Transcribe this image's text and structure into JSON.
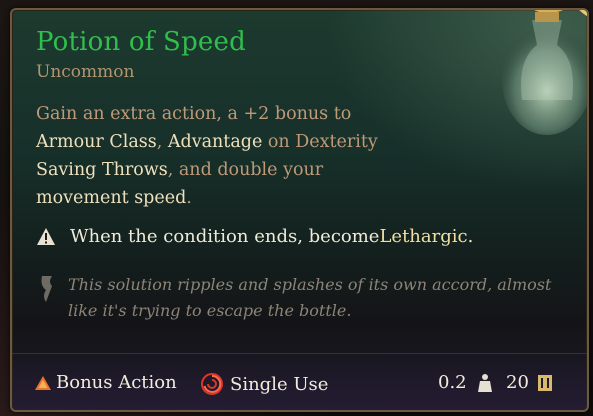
{
  "item": {
    "name": "Potion of Speed",
    "rarity": "Uncommon",
    "desc_part1": "Gain an extra action, a +2 bonus to ",
    "desc_hl1": "Armour Class",
    "desc_part2": ", ",
    "desc_hl2": "Advantage",
    "desc_part3": " on Dexterity ",
    "desc_hl3": "Saving Throws",
    "desc_part4": ", and double your ",
    "desc_hl4": "movement speed",
    "desc_part5": ".",
    "warning_part1": "When the condition ends, become ",
    "warning_hl": "Lethargic",
    "warning_part2": ".",
    "flavor": "This solution ripples and splashes of its own accord, almost like it's trying to escape the bottle."
  },
  "footer": {
    "action_type": "Bonus Action",
    "use_type": "Single Use",
    "weight": "0.2",
    "value": "20"
  },
  "colors": {
    "title": "#2fbf4c",
    "rarity": "#b49570",
    "highlight": "#efe0bd",
    "description": "#bf9a78"
  },
  "icons": {
    "action": "triangle-icon",
    "use": "spiral-icon",
    "weight": "weight-icon",
    "value": "coin-icon",
    "warning": "warning-icon",
    "flavor": "scroll-icon"
  }
}
